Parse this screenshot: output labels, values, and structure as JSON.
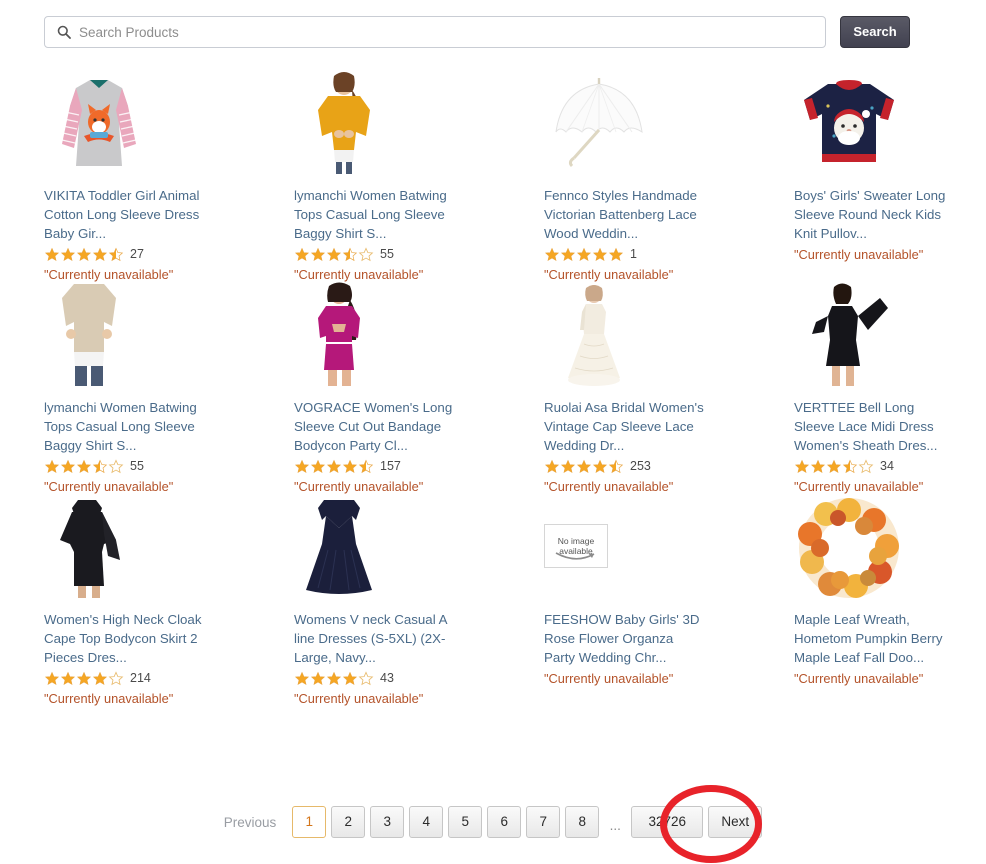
{
  "search": {
    "placeholder": "Search Products",
    "value": "",
    "button_label": "Search",
    "icon": "search-icon"
  },
  "products": [
    {
      "title": "VIKITA Toddler Girl Animal Cotton Long Sleeve Dress Baby Gir...",
      "rating": 4.5,
      "rating_count": "27",
      "availability": "\"Currently unavailable\"",
      "image": "toddler-fox-dress"
    },
    {
      "title": "lymanchi Women Batwing Tops Casual Long Sleeve Baggy Shirt S...",
      "rating": 3.5,
      "rating_count": "55",
      "availability": "\"Currently unavailable\"",
      "image": "mustard-batwing-top"
    },
    {
      "title": "Fennco Styles Handmade Victorian Battenberg Lace Wood Weddin...",
      "rating": 5,
      "rating_count": "1",
      "availability": "\"Currently unavailable\"",
      "image": "white-lace-parasol"
    },
    {
      "title": "Boys' Girls' Sweater Long Sleeve Round Neck Kids Knit Pullov...",
      "rating": null,
      "rating_count": "",
      "availability": "\"Currently unavailable\"",
      "image": "santa-knit-sweater"
    },
    {
      "title": "lymanchi Women Batwing Tops Casual Long Sleeve Baggy Shirt S...",
      "rating": 3.5,
      "rating_count": "55",
      "availability": "\"Currently unavailable\"",
      "image": "beige-batwing-top"
    },
    {
      "title": "VOGRACE Women's Long Sleeve Cut Out Bandage Bodycon Party Cl...",
      "rating": 4.5,
      "rating_count": "157",
      "availability": "\"Currently unavailable\"",
      "image": "magenta-bodycon-dress"
    },
    {
      "title": "Ruolai Asa Bridal Women's Vintage Cap Sleeve Lace Wedding Dr...",
      "rating": 4.5,
      "rating_count": "253",
      "availability": "\"Currently unavailable\"",
      "image": "ivory-wedding-gown"
    },
    {
      "title": "VERTTEE Bell Long Sleeve Lace Midi Dress Women's Sheath Dres...",
      "rating": 3.5,
      "rating_count": "34",
      "availability": "\"Currently unavailable\"",
      "image": "black-bell-sleeve-dress"
    },
    {
      "title": "Women's High Neck Cloak Cape Top Bodycon Skirt 2 Pieces Dres...",
      "rating": 4,
      "rating_count": "214",
      "availability": "\"Currently unavailable\"",
      "image": "black-cloak-cape-set"
    },
    {
      "title": "Womens V neck Casual A line Dresses (S-5XL) (2X-Large, Navy...",
      "rating": 4,
      "rating_count": "43",
      "availability": "\"Currently unavailable\"",
      "image": "navy-aline-dress"
    },
    {
      "title": "FEESHOW Baby Girls' 3D Rose Flower Organza Party Wedding Chr...",
      "rating": null,
      "rating_count": "",
      "availability": "\"Currently unavailable\"",
      "image": "no-image-available"
    },
    {
      "title": "Maple Leaf Wreath, Hometom Pumpkin Berry Maple Leaf Fall Doo...",
      "rating": null,
      "rating_count": "",
      "availability": "\"Currently unavailable\"",
      "image": "maple-leaf-wreath"
    }
  ],
  "no_image_placeholder": {
    "line1": "No image",
    "line2": "available"
  },
  "pagination": {
    "previous_label": "Previous",
    "next_label": "Next",
    "ellipsis": "...",
    "current_page": "1",
    "pages": [
      "1",
      "2",
      "3",
      "4",
      "5",
      "6",
      "7",
      "8"
    ],
    "last_page": "32726"
  },
  "annotation": {
    "target": "last_page_button",
    "color": "#e8232a"
  },
  "colors": {
    "link": "#4a6b8a",
    "star": "#f5a623",
    "unavailable": "#b4532a",
    "search_button": "#4a4a55",
    "current_page_border": "#e6b96a",
    "current_page_text": "#d4761a"
  }
}
